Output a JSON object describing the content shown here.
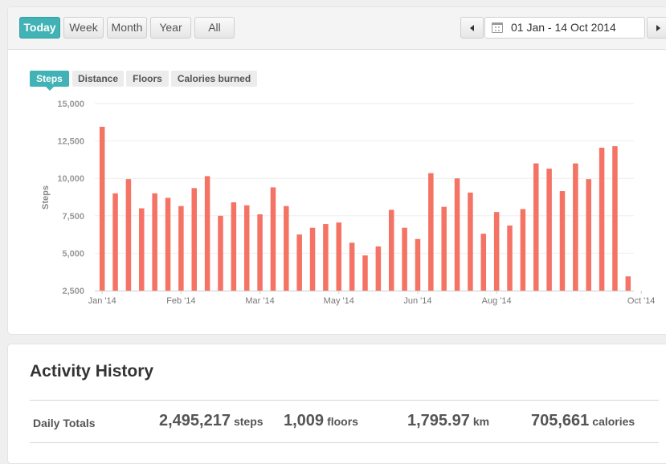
{
  "range_buttons": [
    "Today",
    "Week",
    "Month",
    "Year",
    "All"
  ],
  "date_range": "01 Jan - 14 Oct 2014",
  "metric_tabs": [
    "Steps",
    "Distance",
    "Floors",
    "Calories burned"
  ],
  "colors": {
    "accent": "#41b2b5",
    "bar": "#f57364"
  },
  "chart_data": {
    "type": "bar",
    "ylabel": "Steps",
    "ylim": [
      2500,
      15000
    ],
    "yticks": [
      15000,
      12500,
      10000,
      7500,
      5000,
      2500
    ],
    "ytick_labels": [
      "15,000",
      "12,500",
      "10,000",
      "7,500",
      "5,000",
      "2,500"
    ],
    "xtick_labels": [
      "Jan '14",
      "Feb '14",
      "Mar '14",
      "May '14",
      "Jun '14",
      "Aug '14",
      "Oct '14"
    ],
    "xtick_bar_index": [
      0,
      6,
      12,
      18,
      24,
      30,
      41
    ],
    "values": [
      13450,
      9000,
      9950,
      8000,
      9000,
      8700,
      8150,
      9350,
      10150,
      7500,
      8400,
      8200,
      7600,
      9400,
      8150,
      6250,
      6700,
      6950,
      7050,
      5700,
      4850,
      5450,
      7900,
      6700,
      5950,
      10350,
      8100,
      10000,
      9050,
      6300,
      7750,
      6850,
      7950,
      11000,
      10650,
      9150,
      11000,
      9950,
      12050,
      12150,
      3450
    ]
  },
  "activity": {
    "title": "Activity History",
    "totals_label": "Daily Totals",
    "steps": {
      "value": "2,495,217",
      "unit": "steps"
    },
    "floors": {
      "value": "1,009",
      "unit": "floors"
    },
    "distance": {
      "value": "1,795.97",
      "unit": "km"
    },
    "calories": {
      "value": "705,661",
      "unit": "calories"
    }
  }
}
